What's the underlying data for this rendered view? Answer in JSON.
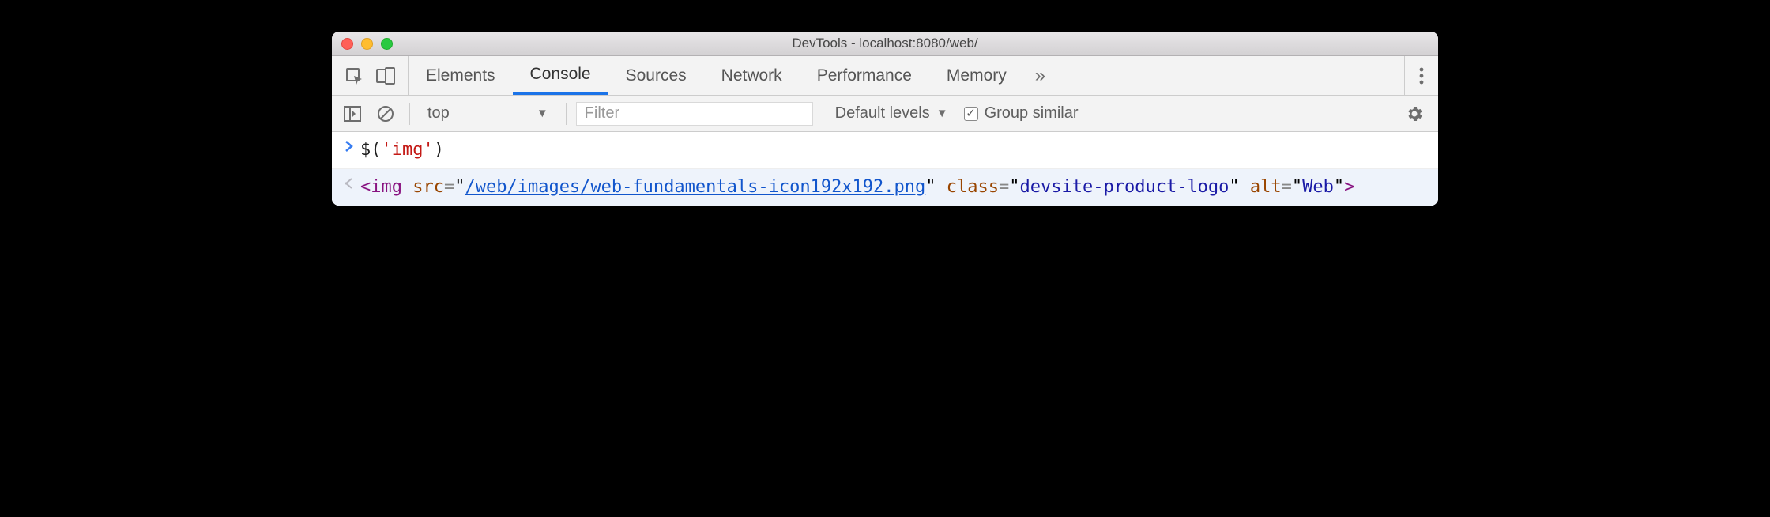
{
  "window": {
    "title": "DevTools - localhost:8080/web/"
  },
  "tabs": {
    "items": [
      "Elements",
      "Console",
      "Sources",
      "Network",
      "Performance",
      "Memory"
    ],
    "active_index": 1,
    "overflow_glyph": "»"
  },
  "toolbar": {
    "context": "top",
    "filter_placeholder": "Filter",
    "levels_label": "Default levels",
    "group_similar_label": "Group similar",
    "group_similar_checked": true
  },
  "console": {
    "input": {
      "fn": "$",
      "arg_quoted": "'img'"
    },
    "output": {
      "tag": "img",
      "attrs": [
        {
          "name": "src",
          "value": "/web/images/web-fundamentals-icon192x192.png",
          "link": true
        },
        {
          "name": "class",
          "value": "devsite-product-logo",
          "link": false
        },
        {
          "name": "alt",
          "value": "Web",
          "link": false
        }
      ]
    }
  }
}
